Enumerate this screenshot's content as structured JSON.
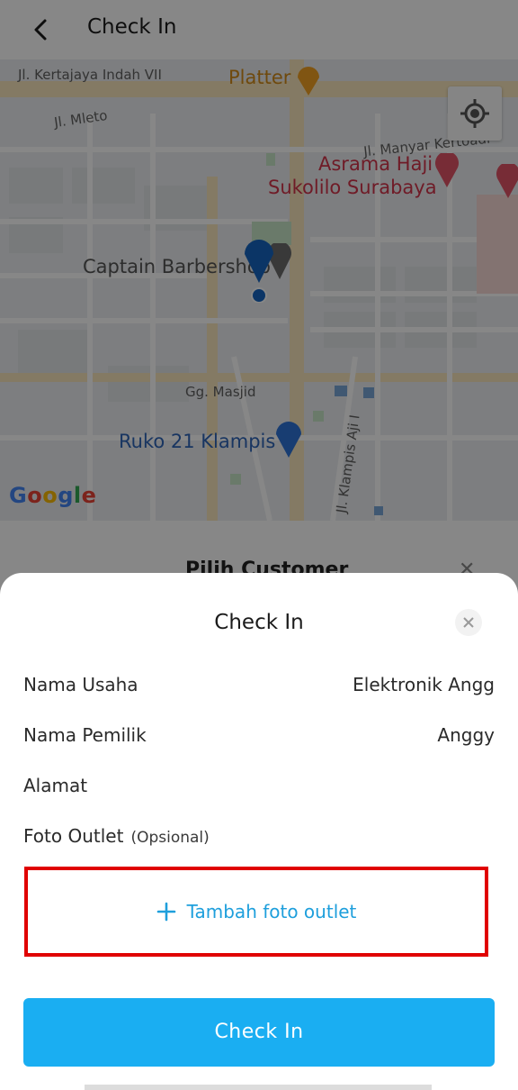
{
  "header": {
    "title": "Check In",
    "back_icon": "back-arrow-icon"
  },
  "map": {
    "streets": [
      "Jl. Kertajaya Indah VII",
      "Jl. Mleto",
      "Jl. Manyar Kertoadi",
      "Gg. Masjid",
      "Jl. Klampis Aji I"
    ],
    "places": {
      "platter": "Platter",
      "asrama_line1": "Asrama Haji",
      "asrama_line2": "Sukolilo Surabaya",
      "barbershop": "Captain Barbershop",
      "ruko": "Ruko 21 Klampis"
    },
    "google_logo": [
      "G",
      "o",
      "o",
      "g",
      "l",
      "e"
    ],
    "locate_icon": "my-location-icon"
  },
  "under_sheet": {
    "title": "Pilih Customer"
  },
  "sheet": {
    "title": "Check In",
    "fields": [
      {
        "label": "Nama Usaha",
        "value": "Elektronik Angg"
      },
      {
        "label": "Nama Pemilik",
        "value": "Anggy"
      },
      {
        "label": "Alamat",
        "value": ""
      }
    ],
    "photo": {
      "label": "Foto Outlet",
      "optional": "(Opsional)",
      "add_label": "Tambah foto outlet"
    },
    "submit_label": "Check In"
  },
  "colors": {
    "accent": "#1aaef2",
    "link": "#1e9fdc",
    "highlight": "#e00000",
    "pin": "#1565c0"
  }
}
